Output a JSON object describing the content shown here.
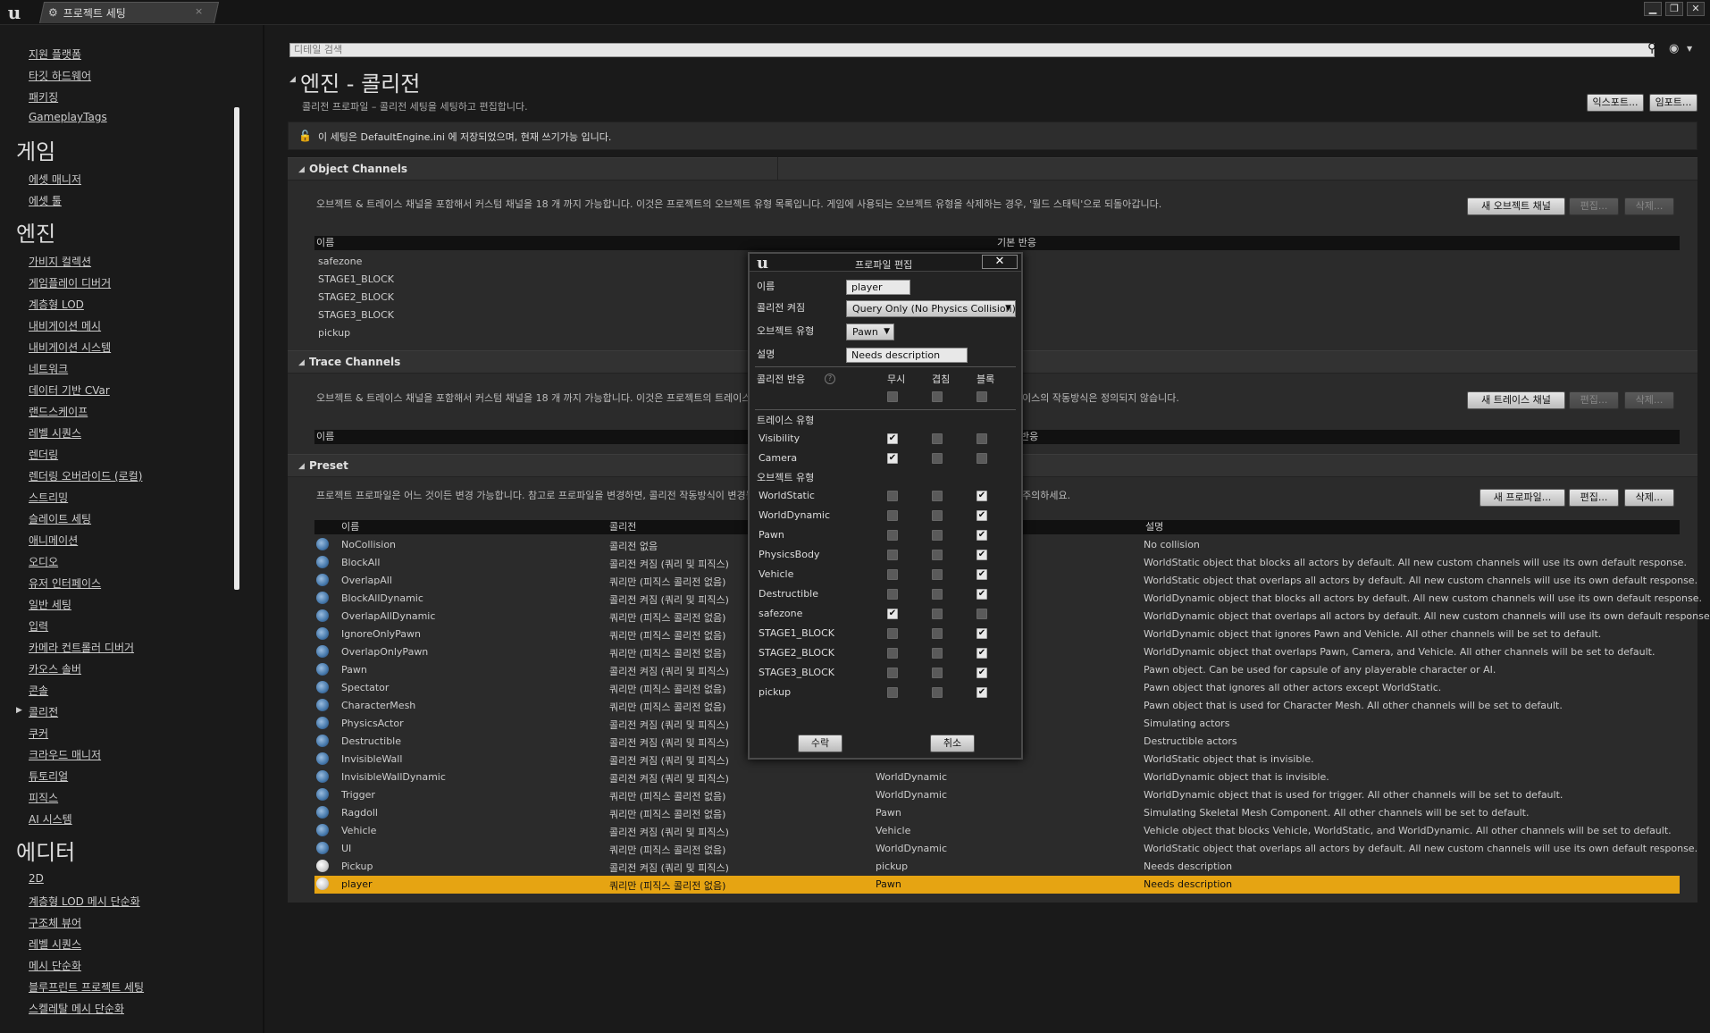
{
  "window": {
    "tab_title": "프로젝트 세팅",
    "tab_close": "×",
    "min": "▁",
    "max": "❐",
    "close": "✕"
  },
  "sidebar": {
    "items_top": [
      "지원 플랫폼",
      "타깃 하드웨어",
      "패키징",
      "GameplayTags"
    ],
    "game_header": "게임",
    "game_items": [
      "에셋 매니저",
      "에셋 툴"
    ],
    "engine_header": "엔진",
    "engine_items": [
      "가비지 컬렉션",
      "게임플레이 디버거",
      "계층형 LOD",
      "내비게이션 메시",
      "내비게이션 시스템",
      "네트워크",
      "데이터 기반 CVar",
      "랜드스케이프",
      "레벨 시퀀스",
      "렌더링",
      "렌더링 오버라이드 (로컬)",
      "스트리밍",
      "슬레이트 세팅",
      "애니메이션",
      "오디오",
      "유저 인터페이스",
      "일반 세팅",
      "입력",
      "카메라 컨트롤러 디버거",
      "카오스 솔버",
      "콘솔",
      "콜리전",
      "쿠커",
      "크라우드 매니저",
      "튜토리얼",
      "피직스",
      "AI 시스템"
    ],
    "editor_header": "에디터",
    "editor_items": [
      "2D",
      "계층형 LOD 메시 단순화",
      "구조체 뷰어",
      "레벨 시퀀스",
      "메시 단순화",
      "블루프린트 프로젝트 세팅",
      "스켈레탈 메시 단순화"
    ]
  },
  "main": {
    "search_placeholder": "디테일 검색",
    "title": "엔진 - 콜리전",
    "subtitle": "콜리전 프로파일 – 콜리전 세팅을 세팅하고 편집합니다.",
    "export_btn": "익스포트...",
    "import_btn": "임포트...",
    "notice": "이 세팅은 DefaultEngine.ini 에 저장되었으며, 현재 쓰기가능 입니다."
  },
  "object_channels": {
    "title": "Object Channels",
    "desc": "오브젝트 & 트레이스 채널을 포함해서 커스텀 채널을 18 개 까지 가능합니다. 이것은 프로젝트의 오브젝트 유형 목록입니다. 게임에 사용되는 오브젝트 유형을 삭제하는 경우, '월드 스태틱'으로 되돌아갑니다.",
    "new_btn": "새 오브젝트 채널",
    "edit_btn": "편집...",
    "delete_btn": "삭제...",
    "col_name": "이름",
    "col_default": "기본 반응",
    "rows": [
      "safezone",
      "STAGE1_BLOCK",
      "STAGE2_BLOCK",
      "STAGE3_BLOCK",
      "pickup"
    ]
  },
  "trace_channels": {
    "title": "Trace Channels",
    "desc_left": "오브젝트 & 트레이스 채널을 포함해서 커스텀 채널을 18 개 까지 가능합니다. 이것은 프로젝트의 트레이스 채",
    "desc_right": "이스의 작동방식은 정의되지 않습니다.",
    "new_btn": "새 트레이스 채널",
    "edit_btn": "편집...",
    "delete_btn": "삭제...",
    "col_name": "이름",
    "col_default": "반응"
  },
  "preset": {
    "title": "Preset",
    "desc_left": "프로젝트 프로파일은 어느 것이든 변경 가능합니다. 참고로 프로파일을 변경하면, 콜리전 작동방식이 변경될",
    "desc_right": "주의하세요.",
    "new_btn": "새 프로파일...",
    "edit_btn": "편집...",
    "delete_btn": "삭제...",
    "col_name": "이름",
    "col_collision": "콜리전",
    "col_desc": "설명",
    "rows": [
      {
        "name": "NoCollision",
        "collision": "콜리전 없음",
        "type": "",
        "desc": "No collision"
      },
      {
        "name": "BlockAll",
        "collision": "콜리전 켜짐 (쿼리 및 피직스)",
        "type": "",
        "desc": "WorldStatic object that blocks all actors by default. All new custom channels will use its own default response."
      },
      {
        "name": "OverlapAll",
        "collision": "쿼리만 (피직스 콜리전 없음)",
        "type": "",
        "desc": "WorldStatic object that overlaps all actors by default. All new custom channels will use its own default response."
      },
      {
        "name": "BlockAllDynamic",
        "collision": "콜리전 켜짐 (쿼리 및 피직스)",
        "type": "",
        "desc": "WorldDynamic object that blocks all actors by default. All new custom channels will use its own default response."
      },
      {
        "name": "OverlapAllDynamic",
        "collision": "쿼리만 (피직스 콜리전 없음)",
        "type": "",
        "desc": "WorldDynamic object that overlaps all actors by default. All new custom channels will use its own default response."
      },
      {
        "name": "IgnoreOnlyPawn",
        "collision": "쿼리만 (피직스 콜리전 없음)",
        "type": "",
        "desc": "WorldDynamic object that ignores Pawn and Vehicle. All other channels will be set to default."
      },
      {
        "name": "OverlapOnlyPawn",
        "collision": "쿼리만 (피직스 콜리전 없음)",
        "type": "",
        "desc": "WorldDynamic object that overlaps Pawn, Camera, and Vehicle. All other channels will be set to default."
      },
      {
        "name": "Pawn",
        "collision": "콜리전 켜짐 (쿼리 및 피직스)",
        "type": "",
        "desc": "Pawn object. Can be used for capsule of any playerable character or AI."
      },
      {
        "name": "Spectator",
        "collision": "쿼리만 (피직스 콜리전 없음)",
        "type": "",
        "desc": "Pawn object that ignores all other actors except WorldStatic."
      },
      {
        "name": "CharacterMesh",
        "collision": "쿼리만 (피직스 콜리전 없음)",
        "type": "",
        "desc": "Pawn object that is used for Character Mesh. All other channels will be set to default."
      },
      {
        "name": "PhysicsActor",
        "collision": "콜리전 켜짐 (쿼리 및 피직스)",
        "type": "",
        "desc": "Simulating actors"
      },
      {
        "name": "Destructible",
        "collision": "콜리전 켜짐 (쿼리 및 피직스)",
        "type": "",
        "desc": "Destructible actors"
      },
      {
        "name": "InvisibleWall",
        "collision": "콜리전 켜짐 (쿼리 및 피직스)",
        "type": "",
        "desc": "WorldStatic object that is invisible."
      },
      {
        "name": "InvisibleWallDynamic",
        "collision": "콜리전 켜짐 (쿼리 및 피직스)",
        "type": "WorldDynamic",
        "desc": "WorldDynamic object that is invisible."
      },
      {
        "name": "Trigger",
        "collision": "쿼리만 (피직스 콜리전 없음)",
        "type": "WorldDynamic",
        "desc": "WorldDynamic object that is used for trigger. All other channels will be set to default."
      },
      {
        "name": "Ragdoll",
        "collision": "쿼리만 (피직스 콜리전 없음)",
        "type": "Pawn",
        "desc": "Simulating Skeletal Mesh Component. All other channels will be set to default."
      },
      {
        "name": "Vehicle",
        "collision": "콜리전 켜짐 (쿼리 및 피직스)",
        "type": "Vehicle",
        "desc": "Vehicle object that blocks Vehicle, WorldStatic, and WorldDynamic. All other channels will be set to default."
      },
      {
        "name": "UI",
        "collision": "쿼리만 (피직스 콜리전 없음)",
        "type": "WorldDynamic",
        "desc": "WorldStatic object that overlaps all actors by default. All new custom channels will use its own default response."
      },
      {
        "name": "Pickup",
        "collision": "콜리전 켜짐 (쿼리 및 피직스)",
        "type": "pickup",
        "desc": "Needs description"
      },
      {
        "name": "player",
        "collision": "쿼리만 (피직스 콜리전 없음)",
        "type": "Pawn",
        "desc": "Needs description"
      }
    ]
  },
  "dialog": {
    "title": "프로파일 편집",
    "close": "✕",
    "name_label": "이름",
    "name_value": "player",
    "collision_label": "콜리전 켜짐",
    "collision_value": "Query Only (No Physics Collision)",
    "objtype_label": "오브젝트 유형",
    "objtype_value": "Pawn",
    "desc_label": "설명",
    "desc_value": "Needs description",
    "response_label": "콜리전 반응",
    "col_ignore": "무시",
    "col_overlap": "겹침",
    "col_block": "블록",
    "trace_header": "트레이스 유형",
    "object_header": "오브젝트 유형",
    "trace_rows": [
      {
        "name": "Visibility",
        "state": [
          1,
          0,
          0
        ]
      },
      {
        "name": "Camera",
        "state": [
          1,
          0,
          0
        ]
      }
    ],
    "object_rows": [
      {
        "name": "WorldStatic",
        "state": [
          0,
          0,
          1
        ]
      },
      {
        "name": "WorldDynamic",
        "state": [
          0,
          0,
          1
        ]
      },
      {
        "name": "Pawn",
        "state": [
          0,
          0,
          1
        ]
      },
      {
        "name": "PhysicsBody",
        "state": [
          0,
          0,
          1
        ]
      },
      {
        "name": "Vehicle",
        "state": [
          0,
          0,
          1
        ]
      },
      {
        "name": "Destructible",
        "state": [
          0,
          0,
          1
        ]
      },
      {
        "name": "safezone",
        "state": [
          1,
          0,
          0
        ]
      },
      {
        "name": "STAGE1_BLOCK",
        "state": [
          0,
          0,
          1
        ]
      },
      {
        "name": "STAGE2_BLOCK",
        "state": [
          0,
          0,
          1
        ]
      },
      {
        "name": "STAGE3_BLOCK",
        "state": [
          0,
          0,
          1
        ]
      },
      {
        "name": "pickup",
        "state": [
          0,
          0,
          1
        ]
      }
    ],
    "accept_btn": "수락",
    "cancel_btn": "취소"
  }
}
